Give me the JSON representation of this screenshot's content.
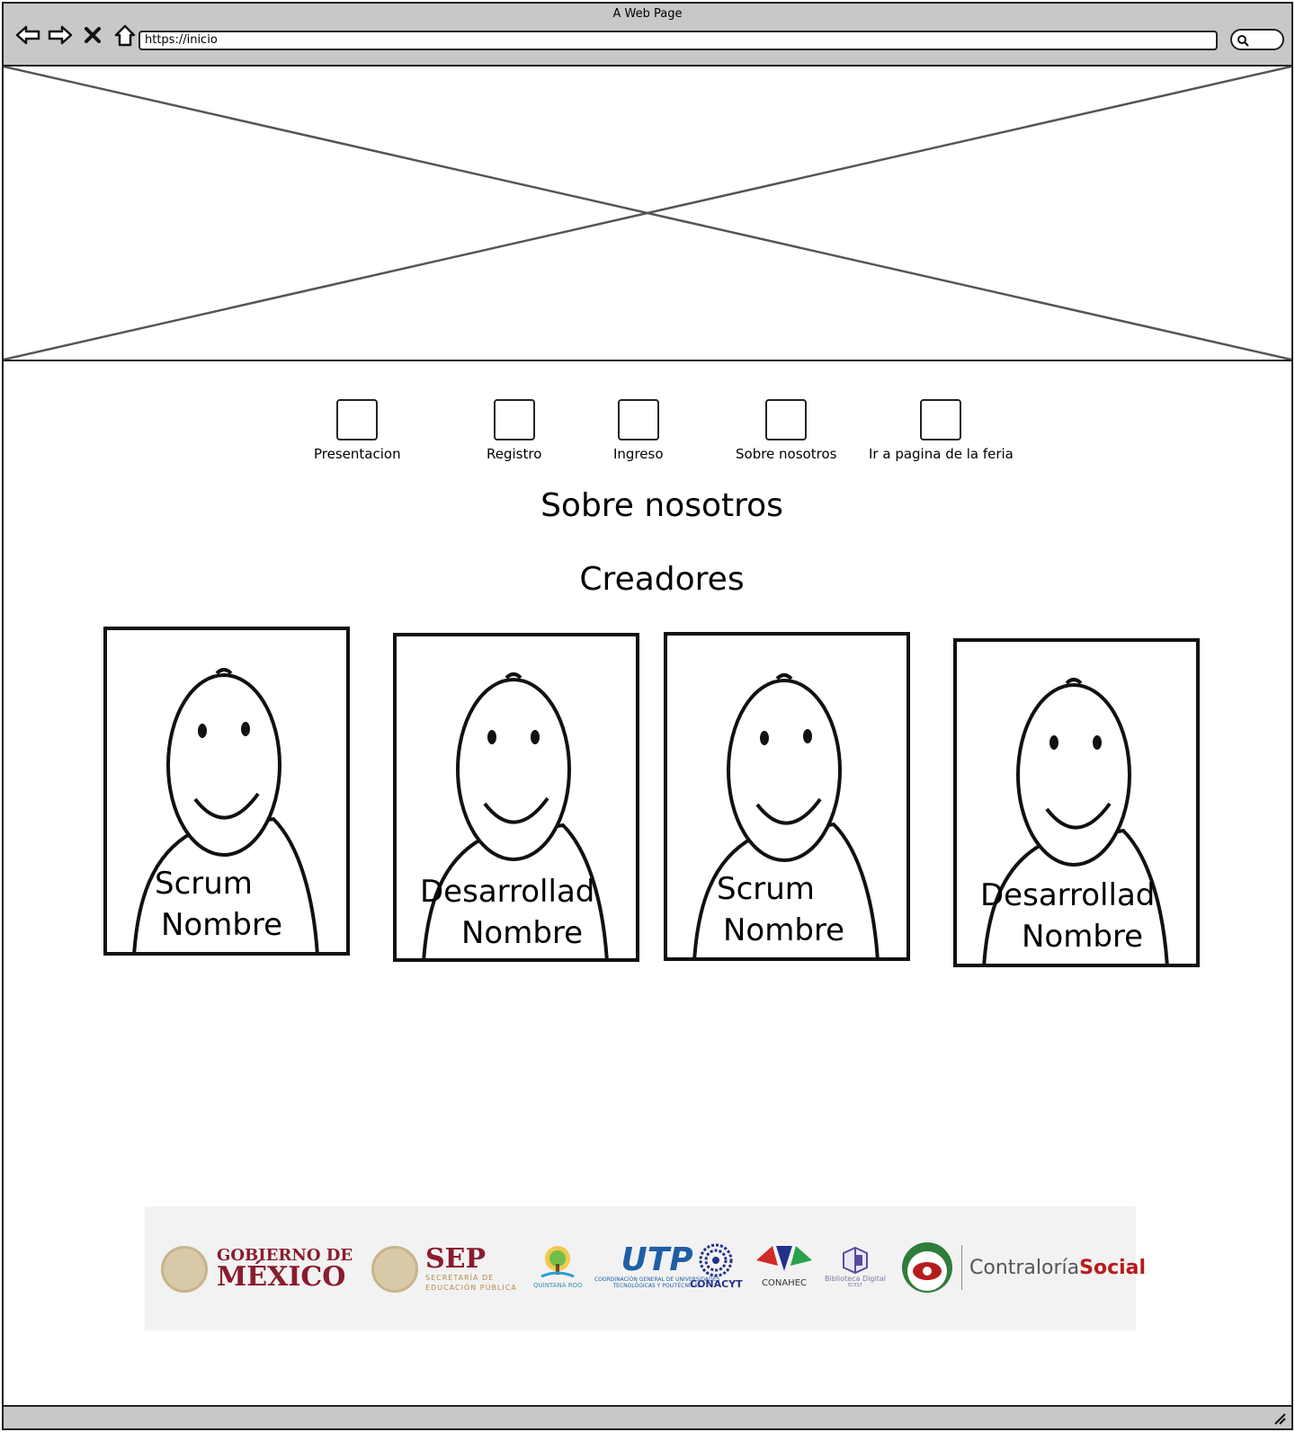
{
  "window": {
    "title": "A Web Page",
    "url": "https://inicio"
  },
  "nav": [
    {
      "label": "Presentacion"
    },
    {
      "label": "Registro"
    },
    {
      "label": "Ingreso"
    },
    {
      "label": "Sobre nosotros"
    },
    {
      "label": "Ir a pagina de la feria"
    }
  ],
  "main": {
    "heading": "Sobre nosotros",
    "subheading": "Creadores"
  },
  "creators": [
    {
      "role": "Scrum",
      "name": "Nombre"
    },
    {
      "role": "Desarrollad",
      "name": "Nombre"
    },
    {
      "role": "Scrum",
      "name": "Nombre"
    },
    {
      "role": "Desarrollad",
      "name": "Nombre"
    }
  ],
  "footer": {
    "gob_line1": "GOBIERNO DE",
    "gob_line2": "MÉXICO",
    "sep_title": "SEP",
    "sep_sub1": "SECRETARÍA DE",
    "sep_sub2": "EDUCACIÓN PÚBLICA",
    "qroo": "QUINTANA ROO",
    "utp": "UTP",
    "utp_sub1": "COORDINACIÓN GENERAL DE UNIVERSIDADES",
    "utp_sub2": "TECNOLÓGICAS Y POLITÉCNICAS",
    "conacyt": "CONACYT",
    "conahec": "CONAHEC",
    "biblioteca": "Biblioteca Digital",
    "biblioteca_sub": "ECEST",
    "contraloria": "Contraloría",
    "contraloria_bold": "Social"
  }
}
